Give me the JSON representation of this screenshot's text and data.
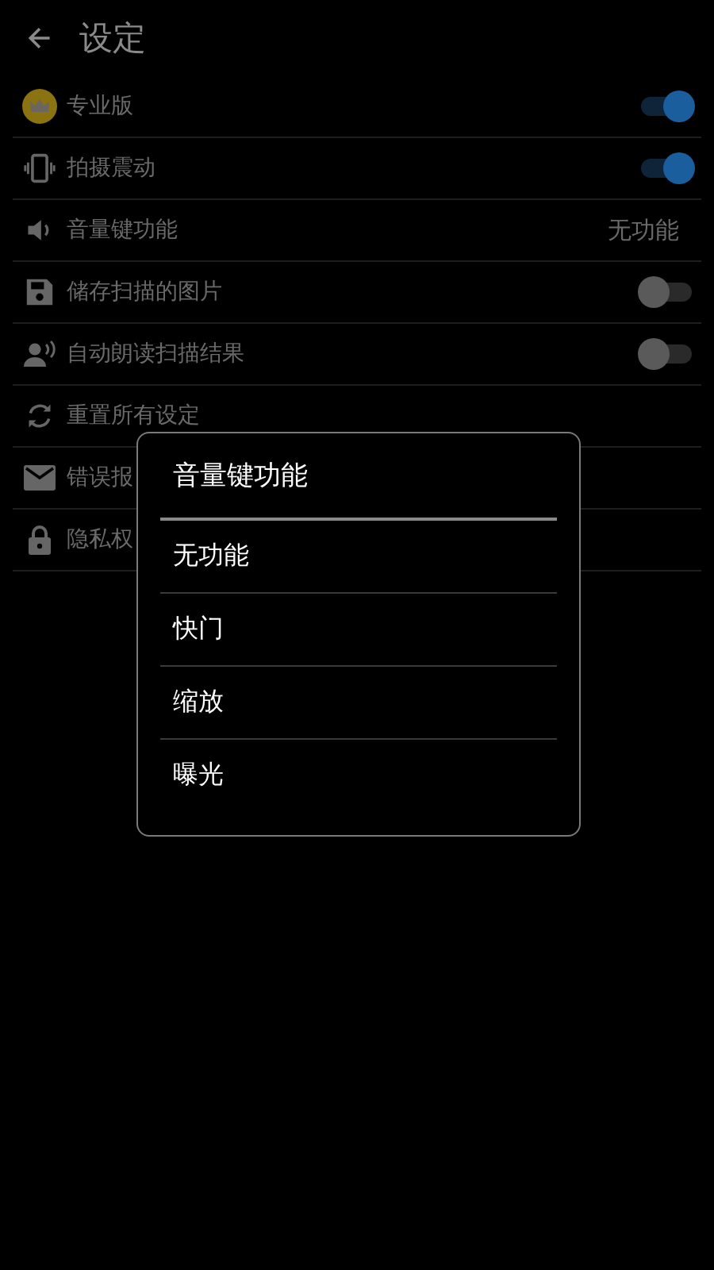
{
  "header": {
    "title": "设定"
  },
  "settings": [
    {
      "kind": "toggle",
      "label": "专业版",
      "on": true
    },
    {
      "kind": "toggle",
      "label": "拍摄震动",
      "on": true
    },
    {
      "kind": "value",
      "label": "音量键功能",
      "value": "无功能"
    },
    {
      "kind": "toggle",
      "label": "储存扫描的图片",
      "on": false
    },
    {
      "kind": "toggle",
      "label": "自动朗读扫描结果",
      "on": false
    },
    {
      "kind": "action",
      "label": "重置所有设定"
    },
    {
      "kind": "action",
      "label": "错误报"
    },
    {
      "kind": "action",
      "label": "隐私权"
    }
  ],
  "dialog": {
    "title": "音量键功能",
    "options": [
      "无功能",
      "快门",
      "缩放",
      "曝光"
    ]
  }
}
